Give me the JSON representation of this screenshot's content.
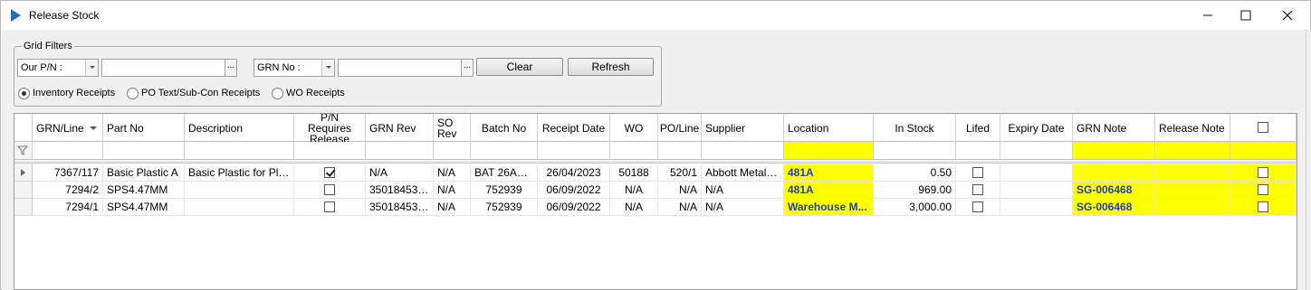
{
  "window": {
    "title": "Release Stock"
  },
  "filters": {
    "group_label": "Grid Filters",
    "part_combo": "Our P/N :",
    "grn_combo": "GRN No :",
    "part_value": "",
    "grn_value": "",
    "clear_label": "Clear",
    "refresh_label": "Refresh",
    "radios": [
      {
        "label": "Inventory Receipts",
        "selected": true
      },
      {
        "label": "PO Text/Sub-Con Receipts",
        "selected": false
      },
      {
        "label": "WO Receipts",
        "selected": false
      }
    ]
  },
  "grid": {
    "headers": {
      "grn_line": "GRN/Line",
      "part_no": "Part No",
      "description": "Description",
      "pn_requires_release": "P/N Requires Release",
      "grn_rev": "GRN Rev",
      "so_rev": "SO Rev",
      "batch_no": "Batch No",
      "receipt_date": "Receipt Date",
      "wo": "WO",
      "po_line": "PO/Line",
      "supplier": "Supplier",
      "location": "Location",
      "in_stock": "In Stock",
      "lifed": "Lifed",
      "expiry_date": "Expiry Date",
      "grn_note": "GRN Note",
      "release_note": "Release Note"
    },
    "rows": [
      {
        "grn_line": "7367/117",
        "part_no": "Basic Plastic A",
        "description": "Basic Plastic for Plast...",
        "pn_requires_release": true,
        "grn_rev": "N/A",
        "so_rev": "N/A",
        "batch_no": "BAT 26Apr...",
        "receipt_date": "26/04/2023",
        "wo": "50188",
        "po_line": "520/1",
        "supplier": "Abbott Metal S...",
        "location": "481A",
        "in_stock": "0.50",
        "lifed": false,
        "expiry_date": "",
        "grn_note": "",
        "release_note": "",
        "selected": false
      },
      {
        "grn_line": "7294/2",
        "part_no": "SPS4.47MM",
        "description": "",
        "pn_requires_release": false,
        "grn_rev": "350184537...",
        "so_rev": "N/A",
        "batch_no": "752939",
        "receipt_date": "06/09/2022",
        "wo": "N/A",
        "po_line": "N/A",
        "supplier": "N/A",
        "location": "481A",
        "in_stock": "969.00",
        "lifed": false,
        "expiry_date": "",
        "grn_note": "SG-006468",
        "release_note": "",
        "selected": false
      },
      {
        "grn_line": "7294/1",
        "part_no": "SPS4.47MM",
        "description": "",
        "pn_requires_release": false,
        "grn_rev": "350184537...",
        "so_rev": "N/A",
        "batch_no": "752939",
        "receipt_date": "06/09/2022",
        "wo": "N/A",
        "po_line": "N/A",
        "supplier": "N/A",
        "location": "Warehouse M...",
        "in_stock": "3,000.00",
        "lifed": false,
        "expiry_date": "",
        "grn_note": "SG-006468",
        "release_note": "",
        "selected": false
      }
    ]
  },
  "colors": {
    "highlight": "#ffff00",
    "note_text": "#1f3fbf",
    "title_icon": "#2a6cc4"
  }
}
